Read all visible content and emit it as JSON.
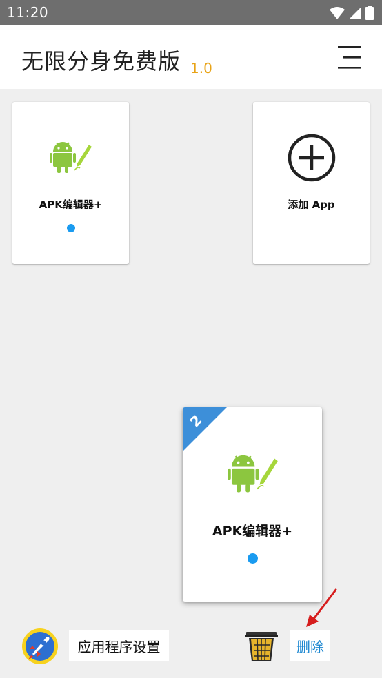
{
  "status_bar": {
    "time": "11:20"
  },
  "header": {
    "title": "无限分身免费版",
    "version": "1.0"
  },
  "cards": {
    "app1": {
      "label": "APK编辑器+"
    },
    "add": {
      "label": "添加 App"
    },
    "dragged": {
      "label": "APK编辑器+",
      "badge": "2"
    }
  },
  "bottom_bar": {
    "settings_label": "应用程序设置",
    "delete_label": "删除"
  },
  "colors": {
    "accent_blue": "#1a9bf0",
    "version": "#e8a317",
    "badge": "#3d8fd9",
    "delete_text": "#1a86d0",
    "arrow": "#d61d1d"
  }
}
